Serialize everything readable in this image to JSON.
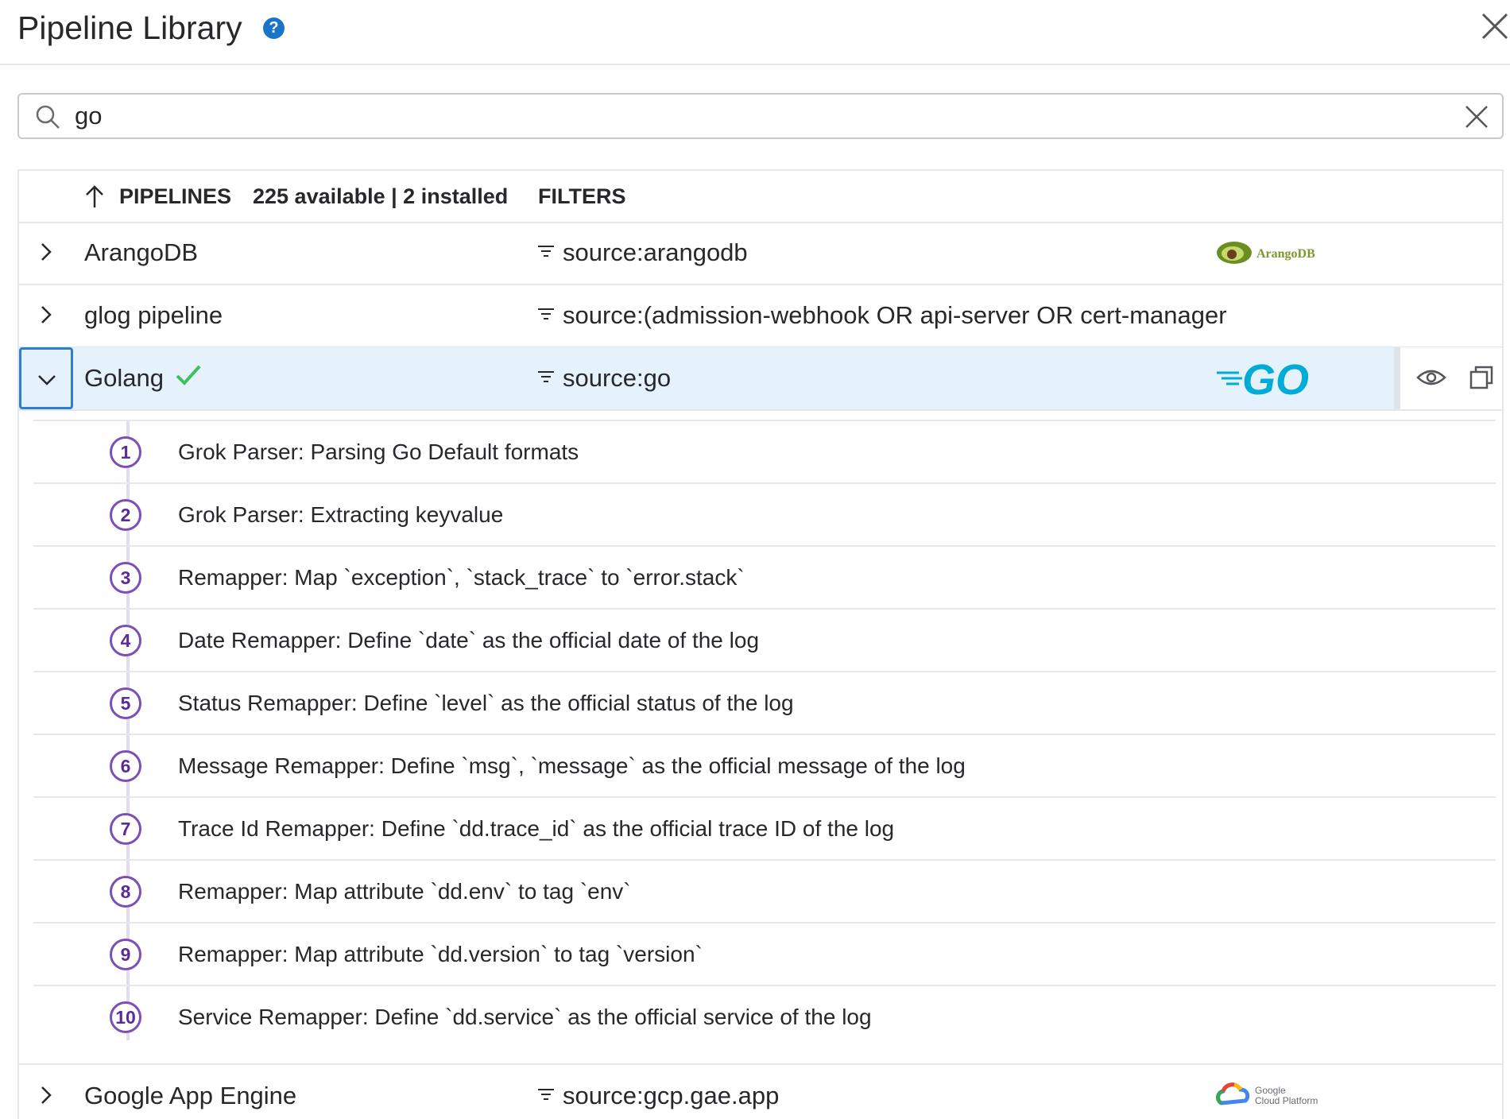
{
  "header": {
    "title": "Pipeline Library",
    "help_icon": "question-circle-icon",
    "close_icon": "close-icon"
  },
  "search": {
    "value": "go",
    "placeholder": ""
  },
  "columns": {
    "pipelines": "PIPELINES",
    "counts": "225 available | 2 installed",
    "filters": "FILTERS"
  },
  "rows": [
    {
      "name": "ArangoDB",
      "filter": "source:arangodb",
      "logo": "ArangoDB",
      "expanded": false
    },
    {
      "name": "glog pipeline",
      "filter": "source:(admission-webhook OR api-server OR cert-manager",
      "expanded": false
    },
    {
      "name": "Golang",
      "filter": "source:go",
      "logo": "GO",
      "installed": true,
      "expanded": true
    },
    {
      "name": "Google App Engine",
      "filter": "source:gcp.gae.app",
      "logo_text": [
        "Google",
        "Cloud Platform"
      ],
      "expanded": false
    }
  ],
  "steps": [
    {
      "n": "1",
      "text": "Grok Parser: Parsing Go Default formats"
    },
    {
      "n": "2",
      "text": "Grok Parser: Extracting keyvalue"
    },
    {
      "n": "3",
      "text": "Remapper: Map `exception`, `stack_trace` to `error.stack`"
    },
    {
      "n": "4",
      "text": "Date Remapper: Define `date` as the official date of the log"
    },
    {
      "n": "5",
      "text": "Status Remapper: Define `level` as the official status of the log"
    },
    {
      "n": "6",
      "text": "Message Remapper: Define `msg`, `message` as the official message of the log"
    },
    {
      "n": "7",
      "text": "Trace Id Remapper: Define `dd.trace_id` as the official trace ID of the log"
    },
    {
      "n": "8",
      "text": "Remapper: Map attribute `dd.env` to tag `env`"
    },
    {
      "n": "9",
      "text": "Remapper: Map attribute `dd.version` to tag `version`"
    },
    {
      "n": "10",
      "text": "Service Remapper: Define `dd.service` as the official service of the log"
    }
  ],
  "colors": {
    "accent": "#2d7fd1",
    "selected_row": "#e6f2fb",
    "step_purple": "#7c4fb8",
    "check_green": "#3fbf5f",
    "go_blue": "#00acd7"
  }
}
